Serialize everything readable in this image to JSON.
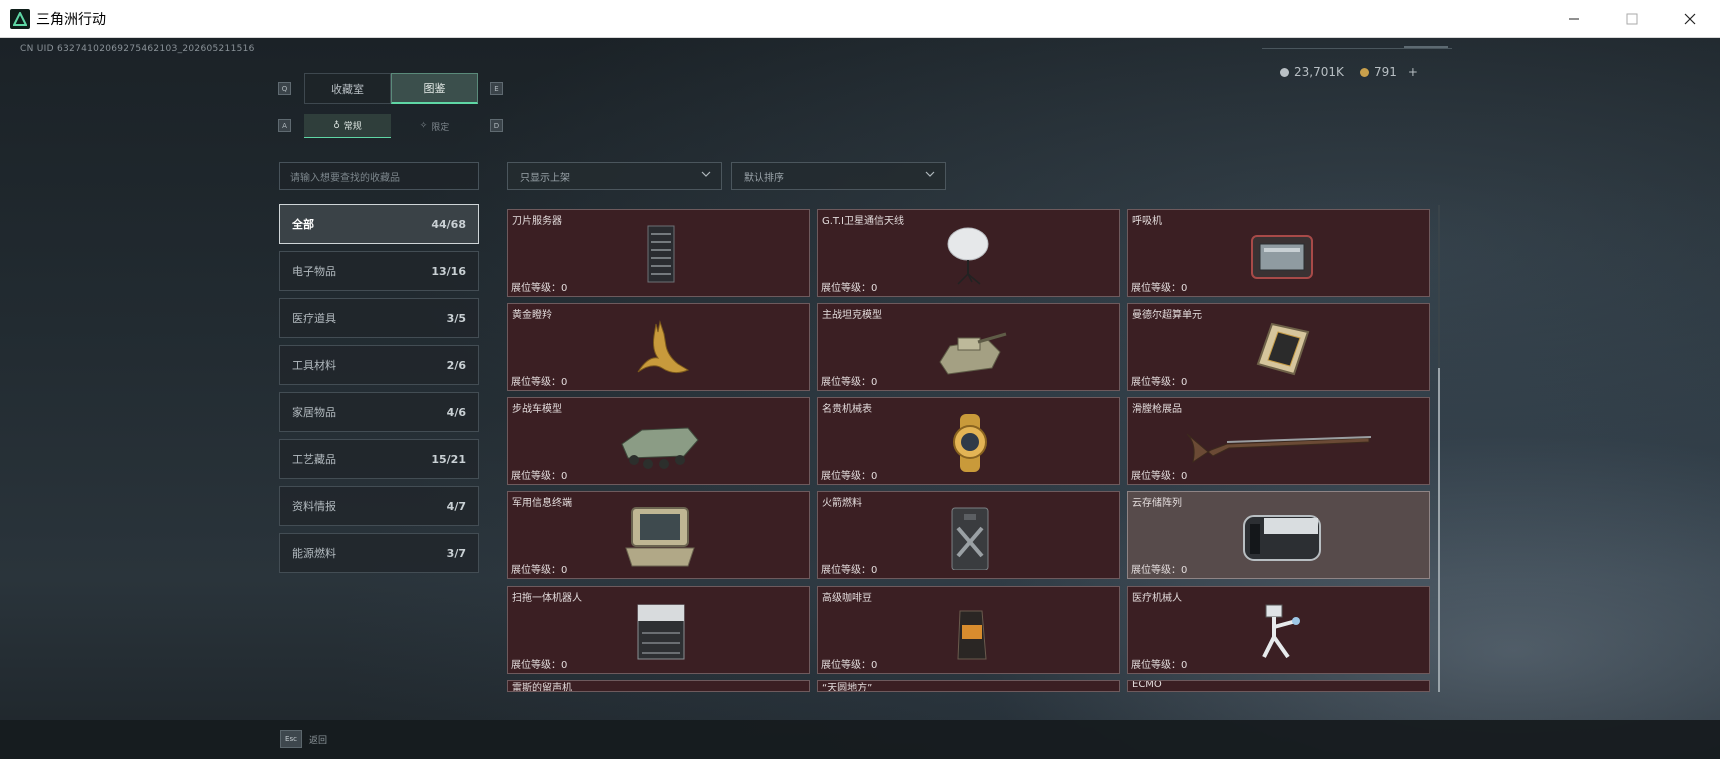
{
  "window": {
    "title": "三角洲行动"
  },
  "header": {
    "uid": "CN UID 6327410206927546210З_202605211516",
    "currency_silver": "23,701K",
    "currency_gold": "791",
    "add_symbol": "+"
  },
  "keyhints": {
    "q": "Q",
    "e": "E",
    "a": "A",
    "d": "D",
    "esc": "Esc"
  },
  "tabs": [
    {
      "label": "收藏室"
    },
    {
      "label": "图鉴"
    }
  ],
  "subtabs": [
    {
      "label": "常规"
    },
    {
      "label": "限定"
    }
  ],
  "search": {
    "placeholder": "请输入想要查找的收藏品"
  },
  "filters": {
    "shelf": "只显示上架",
    "sort": "默认排序"
  },
  "categories": [
    {
      "label": "全部",
      "count": "44/68"
    },
    {
      "label": "电子物品",
      "count": "13/16"
    },
    {
      "label": "医疗道具",
      "count": "3/5"
    },
    {
      "label": "工具材料",
      "count": "2/6"
    },
    {
      "label": "家居物品",
      "count": "4/6"
    },
    {
      "label": "工艺藏品",
      "count": "15/21"
    },
    {
      "label": "资料情报",
      "count": "4/7"
    },
    {
      "label": "能源燃料",
      "count": "3/7"
    }
  ],
  "items": [
    {
      "name": "刀片服务器",
      "level": "展位等级：0",
      "icon": "server-icon"
    },
    {
      "name": "G.T.I卫星通信天线",
      "level": "展位等级：0",
      "icon": "satellite-dish-icon"
    },
    {
      "name": "呼吸机",
      "level": "展位等级：0",
      "icon": "ventilator-icon"
    },
    {
      "name": "黄金瞪羚",
      "level": "展位等级：0",
      "icon": "gold-gazelle-icon"
    },
    {
      "name": "主战坦克模型",
      "level": "展位等级：0",
      "icon": "tank-model-icon"
    },
    {
      "name": "曼德尔超算单元",
      "level": "展位等级：0",
      "icon": "supercomputer-unit-icon"
    },
    {
      "name": "步战车模型",
      "level": "展位等级：0",
      "icon": "ifv-model-icon"
    },
    {
      "name": "名贵机械表",
      "level": "展位等级：0",
      "icon": "watch-icon"
    },
    {
      "name": "滑膛枪展品",
      "level": "展位等级：0",
      "icon": "musket-icon"
    },
    {
      "name": "军用信息终端",
      "level": "展位等级：0",
      "icon": "military-terminal-icon"
    },
    {
      "name": "火箭燃料",
      "level": "展位等级：0",
      "icon": "rocket-fuel-icon"
    },
    {
      "name": "云存储阵列",
      "level": "展位等级：0",
      "icon": "storage-array-icon"
    },
    {
      "name": "扫拖一体机器人",
      "level": "展位等级：0",
      "icon": "robot-vacuum-icon"
    },
    {
      "name": "高级咖啡豆",
      "level": "展位等级：0",
      "icon": "coffee-bag-icon"
    },
    {
      "name": "医疗机械人",
      "level": "展位等级：0",
      "icon": "medical-robot-icon"
    },
    {
      "name": "雷斯的留声机",
      "level": "",
      "icon": ""
    },
    {
      "name": "“天圆地方”",
      "level": "",
      "icon": ""
    },
    {
      "name": "ECMO",
      "level": "",
      "icon": ""
    }
  ],
  "footer": {
    "back_label": "返回"
  },
  "colors": {
    "accent": "#5fd7a5",
    "card_bg": "#3b1f23",
    "card_highlight": "#574b4b"
  }
}
